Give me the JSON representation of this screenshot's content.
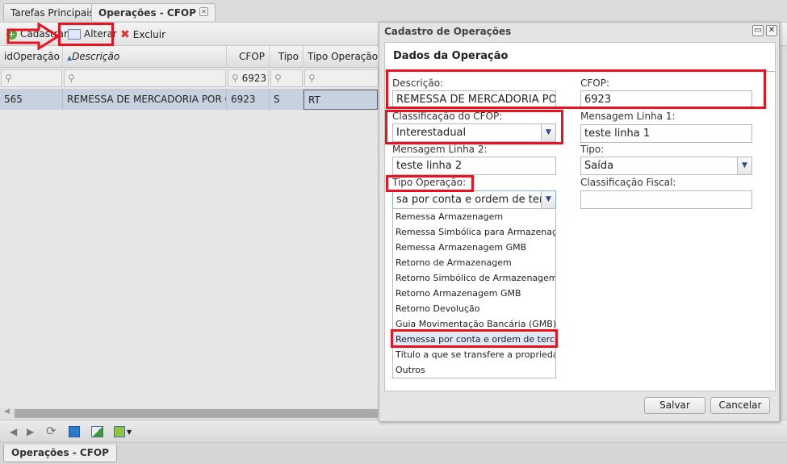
{
  "tabs": [
    {
      "label": "Tarefas Principais"
    },
    {
      "label": "Operações - CFOP"
    }
  ],
  "toolbar": {
    "cadastrar": "Cadastrar",
    "alterar": "Alterar",
    "excluir": "Excluir"
  },
  "grid": {
    "columns": [
      "idOperação",
      "Descrição",
      "CFOP",
      "Tipo",
      "Tipo Operação"
    ],
    "sorted_column": "Descrição",
    "filters": {
      "cfop": "6923"
    },
    "rows": [
      {
        "id": "565",
        "descricao": "REMESSA DE MERCADORIA POR C...",
        "cfop": "6923",
        "tipo": "S",
        "tipo_operacao": "RT"
      }
    ]
  },
  "bottom_tab": "Operações - CFOP",
  "dialog": {
    "title": "Cadastro de Operações",
    "section": "Dados da Operação",
    "fields": {
      "descricao": {
        "label": "Descrição:",
        "value": "REMESSA DE MERCADORIA POR CONTA E ORDEM"
      },
      "cfop": {
        "label": "CFOP:",
        "value": "6923"
      },
      "classificacao": {
        "label": "Classificação do CFOP:",
        "value": "Interestadual"
      },
      "msg1": {
        "label": "Mensagem Linha 1:",
        "value": "teste linha 1"
      },
      "msg2": {
        "label": "Mensagem Linha 2:",
        "value": "teste linha 2"
      },
      "tipo": {
        "label": "Tipo:",
        "value": "Saída"
      },
      "tipo_operacao": {
        "label": "Tipo Operação:",
        "value": "sa por conta e ordem de terceiros"
      },
      "classificacao_fiscal": {
        "label": "Classificação Fiscal:",
        "value": ""
      }
    },
    "options": [
      "Remessa Armazenagem",
      "Remessa Simbólica para Armazenagem",
      "Remessa Armazenagem GMB",
      "Retorno de Armazenagem",
      "Retorno Simbólico de Armazenagem",
      "Retorno Armazenagem GMB",
      "Retorno Devolução",
      "Guia Movimentação Bancária (GMB)",
      "Remessa por conta e ordem de terceir...",
      "Título a que se transfere a propriedade",
      "Outros"
    ],
    "selected_option": "Remessa por conta e ordem de terceir...",
    "salvar": "Salvar",
    "cancelar": "Cancelar"
  },
  "colors": {
    "highlight": "#e8131f",
    "row_selected": "#c8d1df"
  }
}
